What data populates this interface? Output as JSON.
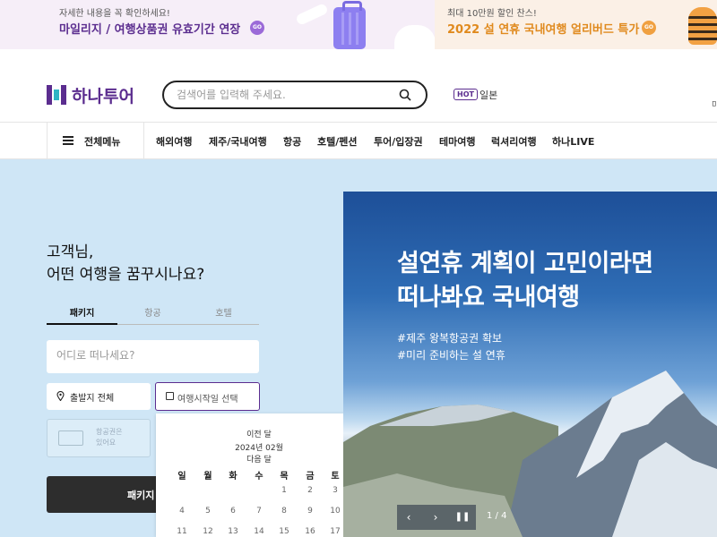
{
  "banners": {
    "left": {
      "small": "자세한 내용을 꼭 확인하세요!",
      "big": "마일리지 / 여행상품권 유효기간 연장",
      "go": "GO"
    },
    "right": {
      "small": "최대 10만원 할인 찬스!",
      "big": "2022 설 연휴 국내여행 얼리버드 특가",
      "go": "GO"
    }
  },
  "header": {
    "logo": "하나투어",
    "search_placeholder": "검색어를 입력해 주세요.",
    "hot_badge": "HOT",
    "hot_keyword": "일본",
    "edge_text": "미"
  },
  "nav": {
    "all_menu": "전체메뉴",
    "items": [
      "해외여행",
      "제주/국내여행",
      "항공",
      "호텔/펜션",
      "투어/입장권",
      "테마여행",
      "럭셔리여행",
      "하나LIVE"
    ]
  },
  "search_panel": {
    "greeting_line1": "고객님,",
    "greeting_line2": "어떤 여행을 꿈꾸시나요?",
    "tabs": [
      "패키지",
      "항공",
      "호텔"
    ],
    "active_tab": "패키지",
    "destination_placeholder": "어디로 떠나세요?",
    "departure": "출발지 전체",
    "date_placeholder": "여행시작일 선택",
    "ticket_line1": "항공권은",
    "ticket_line2": "있어요",
    "search_button": "패키지 검색"
  },
  "calendar": {
    "prev": "이전 달",
    "month": "2024년 02월",
    "next": "다음 달",
    "weekdays": [
      "일",
      "월",
      "화",
      "수",
      "목",
      "금",
      "토"
    ],
    "week1": [
      "",
      "",
      "",
      "",
      "1",
      "2",
      "3"
    ],
    "week2": [
      "4",
      "5",
      "6",
      "7",
      "8",
      "9",
      "10"
    ],
    "week3": [
      "11",
      "12",
      "13",
      "14",
      "15",
      "16",
      "17"
    ]
  },
  "promo": {
    "title_line1": "설연휴 계획이 고민이라면",
    "title_line2": "떠나봐요 국내여행",
    "tag1": "#제주 왕복항공권 확보",
    "tag2": "#미리 준비하는 설 연휴",
    "pager": "1 / 4"
  },
  "colors": {
    "brand": "#5b2d8f",
    "go_left": "#9b6ad8",
    "go_right": "#f0a040",
    "hero_bg": "#cfe6f6"
  }
}
